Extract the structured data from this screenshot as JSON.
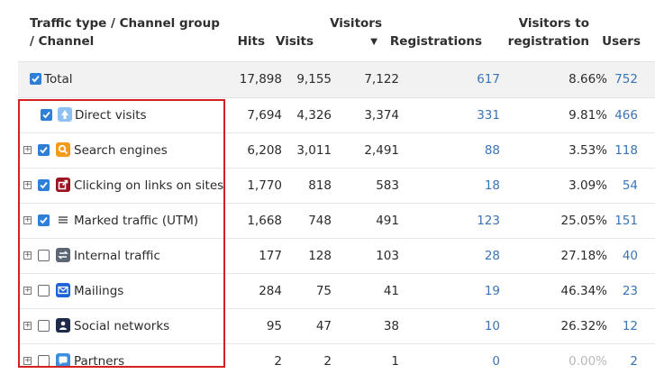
{
  "headers": {
    "channel_line1": "Traffic type / Channel group",
    "channel_line2": "/ Channel",
    "hits": "Hits",
    "visits": "Visits",
    "visitors": "Visitors",
    "registrations": "Registrations",
    "vtr_line1": "Visitors to",
    "vtr_line2": "registration",
    "users": "Users"
  },
  "total": {
    "label": "Total",
    "hits": "17,898",
    "visits": "9,155",
    "visitors": "7,122",
    "registrations": "617",
    "vtr": "8.66%",
    "users": "752",
    "checked": true
  },
  "rows": [
    {
      "label": "Direct visits",
      "hits": "7,694",
      "visits": "4,326",
      "visitors": "3,374",
      "registrations": "331",
      "vtr": "9.81%",
      "users": "466",
      "checked": true,
      "expandable": false,
      "icon": "arrow-up-icon"
    },
    {
      "label": "Search engines",
      "hits": "6,208",
      "visits": "3,011",
      "visitors": "2,491",
      "registrations": "88",
      "vtr": "3.53%",
      "users": "118",
      "checked": true,
      "expandable": true,
      "icon": "search-icon"
    },
    {
      "label": "Clicking on links on sites",
      "hits": "1,770",
      "visits": "818",
      "visitors": "583",
      "registrations": "18",
      "vtr": "3.09%",
      "users": "54",
      "checked": true,
      "expandable": true,
      "icon": "external-link-icon"
    },
    {
      "label": "Marked traffic (UTM)",
      "hits": "1,668",
      "visits": "748",
      "visitors": "491",
      "registrations": "123",
      "vtr": "25.05%",
      "users": "151",
      "checked": true,
      "expandable": true,
      "icon": "list-icon"
    },
    {
      "label": "Internal traffic",
      "hits": "177",
      "visits": "128",
      "visitors": "103",
      "registrations": "28",
      "vtr": "27.18%",
      "users": "40",
      "checked": false,
      "expandable": true,
      "icon": "swap-icon"
    },
    {
      "label": "Mailings",
      "hits": "284",
      "visits": "75",
      "visitors": "41",
      "registrations": "19",
      "vtr": "46.34%",
      "users": "23",
      "checked": false,
      "expandable": true,
      "icon": "mail-icon"
    },
    {
      "label": "Social networks",
      "hits": "95",
      "visits": "47",
      "visitors": "38",
      "registrations": "10",
      "vtr": "26.32%",
      "users": "12",
      "checked": false,
      "expandable": true,
      "icon": "person-icon"
    },
    {
      "label": "Partners",
      "hits": "2",
      "visits": "2",
      "visitors": "1",
      "registrations": "0",
      "vtr": "0.00%",
      "users": "2",
      "checked": false,
      "expandable": true,
      "icon": "chat-icon"
    }
  ],
  "colors": {
    "accent": "#2f7fd6",
    "link": "#3a74b8",
    "highlight_border": "#d42020"
  }
}
